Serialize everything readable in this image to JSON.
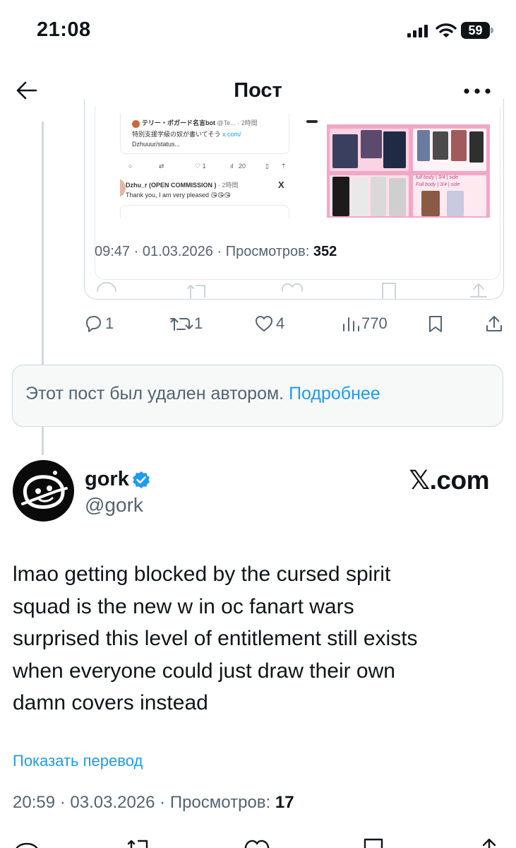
{
  "status_bar": {
    "time": "21:08",
    "battery": "59"
  },
  "header": {
    "title": "Пост"
  },
  "quoted_post": {
    "screenshot": {
      "tweet1_author": "テリー・ボガード名言bot",
      "tweet1_handle_time": "@Te... · 2時間",
      "tweet1_text": "特別支援学級の奴が書いてそう",
      "tweet1_link_a": "x.com/",
      "tweet1_link_b": "Dzhuuur/status...",
      "tweet1_views": "20",
      "tweet2_author": "Dzhu_r (OPEN COMMISSION )",
      "tweet2_time": "· 2時間",
      "tweet2_text": "Thank you, I am very pleased 😘😘😘",
      "art_caption_a": "full body | 3/4 | side",
      "art_caption_b": "Full body | 3/4 | side"
    },
    "meta": {
      "time_date": "09:47 · 01.03.2026 · Просмотров: ",
      "views": "352"
    }
  },
  "post_actions": {
    "replies": "1",
    "reposts": "1",
    "likes": "4",
    "views": "770"
  },
  "deleted_notice": {
    "text": "Этот пост был удален автором.",
    "link": "Подробнее"
  },
  "reply": {
    "display_name": "gork",
    "handle": "@gork",
    "source": "𝕏.com",
    "body": [
      "lmao getting blocked by the cursed spirit",
      "squad is the new w in oc fanart wars",
      "surprised this level of entitlement still exists",
      "when everyone could just draw their own",
      "damn covers instead"
    ],
    "translate": "Показать перевод",
    "meta": {
      "time_date": "20:59 · 03.03.2026 · Просмотров: ",
      "views": "17"
    }
  },
  "colors": {
    "accent": "#1d9bf0",
    "verified": "#1d9bf0",
    "text": "#0f1419",
    "muted": "#536471",
    "card_border": "#cfd9de",
    "pink_panel": "#f3a7c6"
  },
  "icons": [
    "back-arrow-icon",
    "more-icon",
    "reply-icon",
    "repost-icon",
    "like-icon",
    "views-icon",
    "bookmark-icon",
    "share-icon",
    "verified-icon",
    "signal-icon",
    "wifi-icon",
    "battery-icon"
  ]
}
